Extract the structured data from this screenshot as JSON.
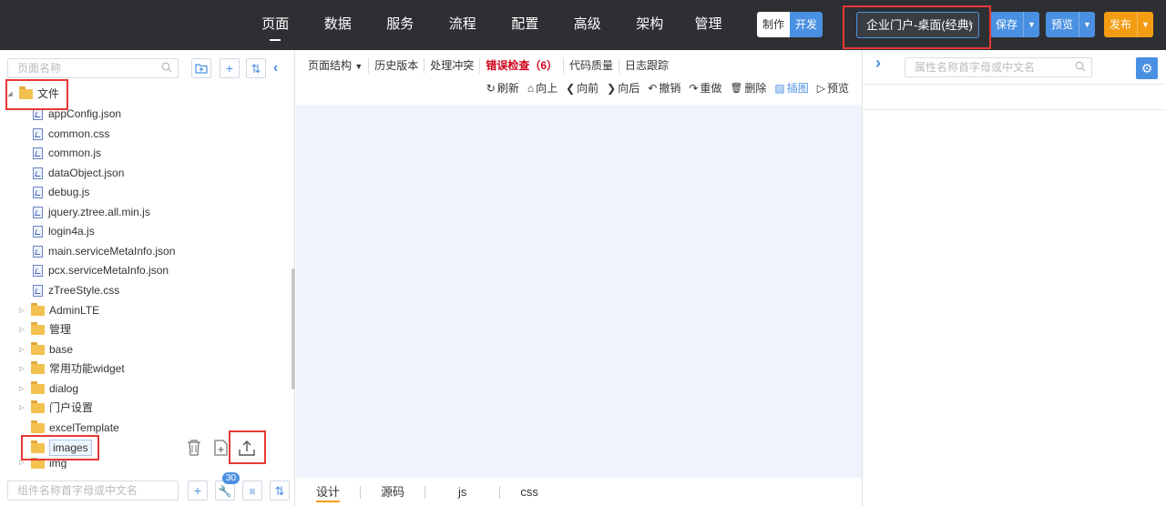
{
  "topnav": {
    "items": [
      {
        "label": "页面",
        "active": true
      },
      {
        "label": "数据"
      },
      {
        "label": "服务"
      },
      {
        "label": "流程"
      },
      {
        "label": "配置"
      },
      {
        "label": "高级"
      },
      {
        "label": "架构"
      },
      {
        "label": "管理"
      }
    ],
    "mode_make": "制作",
    "mode_dev": "开发",
    "portal_select_value": "企业门户-桌面(经典)",
    "save_label": "保存",
    "preview_label": "预览",
    "publish_label": "发布"
  },
  "colors": {
    "accent": "#4a90e2",
    "topbar": "#2d2f33",
    "publish": "#f39c12",
    "error": "#d0021b",
    "highlight": "#e53935"
  },
  "left": {
    "search_placeholder": "页面名称",
    "component_search_placeholder": "组件名称首字母或中文名",
    "badge_count": "30",
    "tree": {
      "root_label": "文件",
      "files": [
        "appConfig.json",
        "common.css",
        "common.js",
        "dataObject.json",
        "debug.js",
        "jquery.ztree.all.min.js",
        "login4a.js",
        "main.serviceMetaInfo.json",
        "pcx.serviceMetaInfo.json",
        "zTreeStyle.css"
      ],
      "folders": [
        "AdminLTE",
        "管理",
        "base",
        "常用功能widget",
        "dialog",
        "门户设置",
        "excelTemplate",
        "images",
        "img"
      ]
    }
  },
  "center": {
    "menu": [
      "页面结构",
      "历史版本",
      "处理冲突",
      "错误检查（6）",
      "代码质量",
      "日志跟踪"
    ],
    "toolbar": [
      {
        "icon": "refresh-icon",
        "glyph": "↻",
        "label": "刷新"
      },
      {
        "icon": "home-icon",
        "glyph": "⌂",
        "label": "向上"
      },
      {
        "icon": "back-icon",
        "glyph": "❮",
        "label": "向前"
      },
      {
        "icon": "forward-icon",
        "glyph": "❯",
        "label": "向后"
      },
      {
        "icon": "undo-icon",
        "glyph": "↶",
        "label": "撤销"
      },
      {
        "icon": "redo-icon",
        "glyph": "↷",
        "label": "重做"
      },
      {
        "icon": "trash-icon",
        "glyph": "🗑",
        "label": "删除"
      },
      {
        "icon": "image-icon",
        "glyph": "▨",
        "label": "插图"
      },
      {
        "icon": "preview-icon",
        "glyph": "▷",
        "label": "预览"
      }
    ],
    "tabs": [
      "设计",
      "源码",
      "js",
      "css"
    ]
  },
  "right": {
    "search_placeholder": "属性名称首字母或中文名"
  }
}
